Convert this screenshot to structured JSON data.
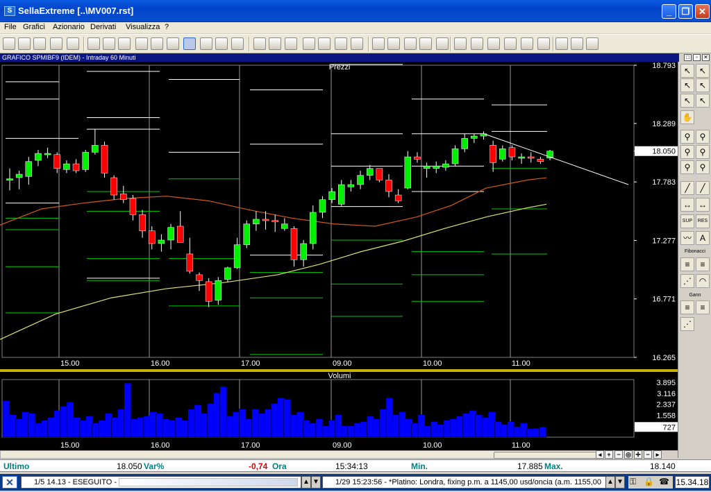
{
  "window": {
    "title": "SellaExtreme [..\\MV007.rst]",
    "min_label": "_",
    "max_label": "❐",
    "close_label": "✕"
  },
  "menu": [
    "File",
    "Grafici",
    "Azionario",
    "Derivati",
    "Visualizza",
    "?"
  ],
  "chart_header": {
    "title": "GRAFICO SPMIBF9 (IDEM) - Intraday 60 Minuti",
    "hdr_buttons": [
      "□",
      "▫",
      "✕"
    ]
  },
  "colors": {
    "bg": "#000000",
    "up": "#00ee00",
    "down": "#ff0000",
    "ma_fast": "#d35a1a",
    "ma_slow": "#e0e070",
    "volume": "#0000ff",
    "trendline": "#ffffff",
    "accent_teal": "#008080"
  },
  "chart_data": [
    {
      "type": "candlestick",
      "title": "Prezzi",
      "x_ticks": [
        "15.00",
        "16.00",
        "17.00",
        "09.00",
        "10.00",
        "11.00"
      ],
      "y_ticks": [
        "18.793",
        "18.289",
        "18.050",
        "17.783",
        "17.277",
        "16.771",
        "16.265"
      ],
      "ylim": [
        16.265,
        18.793
      ],
      "current_price": "18.050",
      "candles": [
        {
          "o": 17.81,
          "h": 17.9,
          "l": 17.71,
          "c": 17.81
        },
        {
          "o": 17.82,
          "h": 17.88,
          "l": 17.72,
          "c": 17.85
        },
        {
          "o": 17.83,
          "h": 18.0,
          "l": 17.76,
          "c": 17.96
        },
        {
          "o": 17.97,
          "h": 18.06,
          "l": 17.92,
          "c": 18.03
        },
        {
          "o": 18.02,
          "h": 18.08,
          "l": 17.99,
          "c": 18.03
        },
        {
          "o": 18.02,
          "h": 18.04,
          "l": 17.86,
          "c": 17.9
        },
        {
          "o": 17.89,
          "h": 17.97,
          "l": 17.86,
          "c": 17.94
        },
        {
          "o": 17.94,
          "h": 17.98,
          "l": 17.86,
          "c": 17.88
        },
        {
          "o": 17.89,
          "h": 18.06,
          "l": 17.87,
          "c": 18.04
        },
        {
          "o": 18.04,
          "h": 18.24,
          "l": 18.02,
          "c": 18.1
        },
        {
          "o": 18.1,
          "h": 18.13,
          "l": 17.82,
          "c": 17.86
        },
        {
          "o": 17.82,
          "h": 17.84,
          "l": 17.63,
          "c": 17.67
        },
        {
          "o": 17.68,
          "h": 17.75,
          "l": 17.6,
          "c": 17.63
        },
        {
          "o": 17.64,
          "h": 17.67,
          "l": 17.45,
          "c": 17.5
        },
        {
          "o": 17.5,
          "h": 17.54,
          "l": 17.3,
          "c": 17.36
        },
        {
          "o": 17.36,
          "h": 17.4,
          "l": 17.2,
          "c": 17.25
        },
        {
          "o": 17.25,
          "h": 17.33,
          "l": 17.18,
          "c": 17.28
        },
        {
          "o": 17.28,
          "h": 17.42,
          "l": 17.2,
          "c": 17.39
        },
        {
          "o": 17.4,
          "h": 17.53,
          "l": 17.26,
          "c": 17.26
        },
        {
          "o": 17.16,
          "h": 17.3,
          "l": 16.99,
          "c": 17.01
        },
        {
          "o": 16.98,
          "h": 17.0,
          "l": 16.84,
          "c": 16.93
        },
        {
          "o": 16.92,
          "h": 16.95,
          "l": 16.7,
          "c": 16.75
        },
        {
          "o": 16.76,
          "h": 16.96,
          "l": 16.72,
          "c": 16.93
        },
        {
          "o": 16.94,
          "h": 17.05,
          "l": 16.92,
          "c": 17.04
        },
        {
          "o": 17.04,
          "h": 17.3,
          "l": 17.03,
          "c": 17.24
        },
        {
          "o": 17.24,
          "h": 17.45,
          "l": 17.21,
          "c": 17.42
        },
        {
          "o": 17.42,
          "h": 17.53,
          "l": 17.36,
          "c": 17.46
        },
        {
          "o": 17.46,
          "h": 17.53,
          "l": 17.37,
          "c": 17.45
        },
        {
          "o": 17.45,
          "h": 17.5,
          "l": 17.35,
          "c": 17.44
        },
        {
          "o": 17.38,
          "h": 17.47,
          "l": 17.36,
          "c": 17.42
        },
        {
          "o": 17.38,
          "h": 17.4,
          "l": 17.05,
          "c": 17.11
        },
        {
          "o": 17.11,
          "h": 17.28,
          "l": 17.05,
          "c": 17.25
        },
        {
          "o": 17.25,
          "h": 17.58,
          "l": 17.2,
          "c": 17.52
        },
        {
          "o": 17.52,
          "h": 17.66,
          "l": 17.47,
          "c": 17.63
        },
        {
          "o": 17.63,
          "h": 17.73,
          "l": 17.6,
          "c": 17.7
        },
        {
          "o": 17.59,
          "h": 17.8,
          "l": 17.57,
          "c": 17.76
        },
        {
          "o": 17.74,
          "h": 17.8,
          "l": 17.7,
          "c": 17.76
        },
        {
          "o": 17.76,
          "h": 17.88,
          "l": 17.72,
          "c": 17.84
        },
        {
          "o": 17.84,
          "h": 17.93,
          "l": 17.8,
          "c": 17.9
        },
        {
          "o": 17.9,
          "h": 17.9,
          "l": 17.78,
          "c": 17.8
        },
        {
          "o": 17.8,
          "h": 17.85,
          "l": 17.65,
          "c": 17.7
        },
        {
          "o": 17.67,
          "h": 17.72,
          "l": 17.6,
          "c": 17.62
        },
        {
          "o": 17.73,
          "h": 18.05,
          "l": 17.72,
          "c": 18.0
        },
        {
          "o": 18.0,
          "h": 18.04,
          "l": 17.95,
          "c": 17.98
        },
        {
          "o": 17.9,
          "h": 17.95,
          "l": 17.82,
          "c": 17.92
        },
        {
          "o": 17.9,
          "h": 17.96,
          "l": 17.86,
          "c": 17.92
        },
        {
          "o": 17.91,
          "h": 17.97,
          "l": 17.88,
          "c": 17.94
        },
        {
          "o": 17.94,
          "h": 18.1,
          "l": 17.92,
          "c": 18.07
        },
        {
          "o": 18.07,
          "h": 18.2,
          "l": 18.04,
          "c": 18.16
        },
        {
          "o": 18.16,
          "h": 18.2,
          "l": 18.12,
          "c": 18.18
        },
        {
          "o": 18.18,
          "h": 18.22,
          "l": 18.15,
          "c": 18.2
        },
        {
          "o": 18.1,
          "h": 18.14,
          "l": 17.87,
          "c": 17.95
        },
        {
          "o": 17.98,
          "h": 18.1,
          "l": 17.96,
          "c": 18.07
        },
        {
          "o": 18.08,
          "h": 18.1,
          "l": 17.97,
          "c": 18.0
        },
        {
          "o": 18.0,
          "h": 18.03,
          "l": 17.94,
          "c": 18.0
        },
        {
          "o": 18.0,
          "h": 18.04,
          "l": 17.95,
          "c": 17.99
        },
        {
          "o": 17.98,
          "h": 18.0,
          "l": 17.94,
          "c": 17.96
        },
        {
          "o": 17.99,
          "h": 18.06,
          "l": 17.97,
          "c": 18.05
        }
      ],
      "ma_fast": [
        [
          0,
          17.41
        ],
        [
          60,
          17.55
        ],
        [
          120,
          17.6
        ],
        [
          180,
          17.64
        ],
        [
          240,
          17.66
        ],
        [
          300,
          17.62
        ],
        [
          360,
          17.54
        ],
        [
          420,
          17.47
        ],
        [
          480,
          17.42
        ],
        [
          540,
          17.4
        ],
        [
          600,
          17.48
        ],
        [
          650,
          17.58
        ],
        [
          700,
          17.73
        ],
        [
          760,
          17.8
        ],
        [
          787,
          17.82
        ]
      ],
      "ma_slow": [
        [
          0,
          16.42
        ],
        [
          80,
          16.64
        ],
        [
          160,
          16.78
        ],
        [
          240,
          16.86
        ],
        [
          320,
          16.91
        ],
        [
          400,
          16.98
        ],
        [
          460,
          17.07
        ],
        [
          520,
          17.18
        ],
        [
          580,
          17.27
        ],
        [
          640,
          17.38
        ],
        [
          700,
          17.48
        ],
        [
          760,
          17.56
        ],
        [
          787,
          17.59
        ]
      ],
      "trendline": {
        "from": [
          697,
          18.2
        ],
        "to": [
          905,
          17.76
        ]
      },
      "levels": [
        {
          "y": 18.65,
          "x": [
            8,
            85
          ],
          "c": "w"
        },
        {
          "y": 18.5,
          "x": [
            8,
            85
          ],
          "c": "w"
        },
        {
          "y": 18.16,
          "x": [
            8,
            113
          ],
          "c": "w"
        },
        {
          "y": 17.6,
          "x": [
            8,
            85
          ],
          "c": "w"
        },
        {
          "y": 17.47,
          "x": [
            8,
            85
          ],
          "c": "g"
        },
        {
          "y": 17.37,
          "x": [
            8,
            85
          ],
          "c": "g"
        },
        {
          "y": 17.05,
          "x": [
            8,
            85
          ],
          "c": "g"
        },
        {
          "y": 16.65,
          "x": [
            8,
            85
          ],
          "c": "g"
        },
        {
          "y": 18.74,
          "x": [
            125,
            230
          ],
          "c": "w"
        },
        {
          "y": 18.34,
          "x": [
            125,
            230
          ],
          "c": "w"
        },
        {
          "y": 18.24,
          "x": [
            125,
            230
          ],
          "c": "w"
        },
        {
          "y": 17.7,
          "x": [
            125,
            230
          ],
          "c": "g"
        },
        {
          "y": 17.53,
          "x": [
            125,
            230
          ],
          "c": "g"
        },
        {
          "y": 17.12,
          "x": [
            125,
            230
          ],
          "c": "g"
        },
        {
          "y": 16.93,
          "x": [
            125,
            230
          ],
          "c": "g"
        },
        {
          "y": 16.95,
          "x": [
            125,
            230
          ],
          "c": "w"
        },
        {
          "y": 18.67,
          "x": [
            243,
            345
          ],
          "c": "w"
        },
        {
          "y": 18.04,
          "x": [
            243,
            345
          ],
          "c": "w"
        },
        {
          "y": 17.81,
          "x": [
            243,
            345
          ],
          "c": "g"
        },
        {
          "y": 17.12,
          "x": [
            243,
            345
          ],
          "c": "g"
        },
        {
          "y": 16.71,
          "x": [
            243,
            345
          ],
          "c": "g"
        },
        {
          "y": 18.58,
          "x": [
            360,
            465
          ],
          "c": "w"
        },
        {
          "y": 18.11,
          "x": [
            360,
            465
          ],
          "c": "w"
        },
        {
          "y": 17.15,
          "x": [
            360,
            465
          ],
          "c": "w"
        },
        {
          "y": 17.0,
          "x": [
            360,
            465
          ],
          "c": "g"
        },
        {
          "y": 16.78,
          "x": [
            360,
            465
          ],
          "c": "g"
        },
        {
          "y": 16.29,
          "x": [
            360,
            465
          ],
          "c": "g"
        },
        {
          "y": 18.8,
          "x": [
            477,
            580
          ],
          "c": "w"
        },
        {
          "y": 18.2,
          "x": [
            477,
            580
          ],
          "c": "w"
        },
        {
          "y": 17.92,
          "x": [
            477,
            580
          ],
          "c": "w"
        },
        {
          "y": 17.57,
          "x": [
            477,
            580
          ],
          "c": "w"
        },
        {
          "y": 17.28,
          "x": [
            477,
            580
          ],
          "c": "g"
        },
        {
          "y": 16.9,
          "x": [
            477,
            580
          ],
          "c": "g"
        },
        {
          "y": 16.62,
          "x": [
            477,
            580
          ],
          "c": "g"
        },
        {
          "y": 18.5,
          "x": [
            593,
            697
          ],
          "c": "w"
        },
        {
          "y": 18.2,
          "x": [
            593,
            697
          ],
          "c": "w"
        },
        {
          "y": 17.92,
          "x": [
            593,
            697
          ],
          "c": "w"
        },
        {
          "y": 17.7,
          "x": [
            593,
            697
          ],
          "c": "w"
        },
        {
          "y": 17.18,
          "x": [
            593,
            697
          ],
          "c": "g"
        },
        {
          "y": 16.98,
          "x": [
            593,
            697
          ],
          "c": "g"
        },
        {
          "y": 16.75,
          "x": [
            593,
            697
          ],
          "c": "g"
        },
        {
          "y": 18.45,
          "x": [
            708,
            788
          ],
          "c": "w"
        },
        {
          "y": 18.22,
          "x": [
            708,
            788
          ],
          "c": "w"
        },
        {
          "y": 17.9,
          "x": [
            708,
            788
          ],
          "c": "g"
        },
        {
          "y": 17.55,
          "x": [
            708,
            788
          ],
          "c": "g"
        },
        {
          "y": 17.16,
          "x": [
            708,
            788
          ],
          "c": "g"
        }
      ]
    },
    {
      "type": "bar",
      "title": "Volumi",
      "x_ticks": [
        "15.00",
        "16.00",
        "17.00",
        "09.00",
        "10.00",
        "11.00"
      ],
      "y_ticks": [
        "3.895",
        "3.116",
        "2.337",
        "1.558"
      ],
      "current": "727",
      "ylim": [
        0,
        4100
      ],
      "values": [
        2600,
        1600,
        1300,
        1800,
        1700,
        1000,
        1200,
        1400,
        1900,
        2200,
        2500,
        1400,
        1200,
        1500,
        1000,
        1200,
        1700,
        1400,
        2000,
        3850,
        1300,
        1400,
        1500,
        1800,
        1700,
        1300,
        1200,
        1400,
        1200,
        2000,
        2300,
        1700,
        2400,
        3150,
        3600,
        1500,
        1800,
        2000,
        1300,
        2000,
        1700,
        2000,
        2400,
        2800,
        2700,
        1600,
        1800,
        1200,
        1000,
        1300,
        800,
        1200,
        1600,
        800,
        800,
        1000,
        1100,
        1500,
        1300,
        2000,
        2800,
        1600,
        1800,
        1300,
        1000,
        1600,
        800,
        1100,
        900,
        1200,
        1300,
        1500,
        1700,
        1900,
        1600,
        1400,
        1800,
        1100,
        900,
        1100,
        750,
        1000,
        600,
        620,
        727
      ]
    }
  ],
  "right_tools": {
    "fibonacci_label": "Fibonacci",
    "gann_label": "Gann",
    "sup_label": "SUP",
    "res_label": "RES"
  },
  "quote_bar": {
    "last_label": "Ultimo",
    "last_value": "18.050",
    "var_label": "Var%",
    "var_value": "-0,74",
    "time_label": "Ora",
    "time_value": "15:34:13",
    "min_label": "Min.",
    "min_value": "17.885",
    "max_label": "Max.",
    "max_value": "18.140"
  },
  "status_bar": {
    "order_text": "1/5 14.13 - ESEGUITO -",
    "news_text": "1/29 15:23:56 - *Platino: Londra, fixing p.m. a 1145,00 usd/oncia (a.m. 1155,00",
    "clock": "15.34.18"
  }
}
